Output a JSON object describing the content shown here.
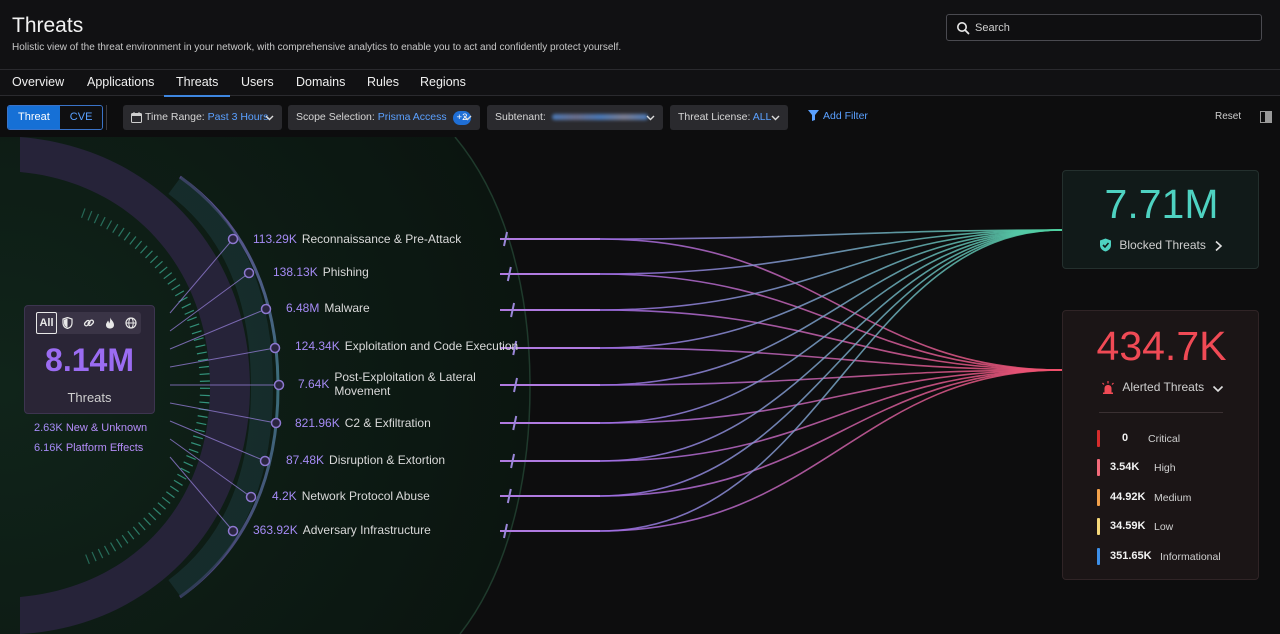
{
  "header": {
    "title": "Threats",
    "subtitle": "Holistic view of the threat environment in your network, with comprehensive analytics to enable you to act and confidently protect yourself.",
    "search_placeholder": "Search"
  },
  "tabs": [
    {
      "label": "Overview"
    },
    {
      "label": "Applications"
    },
    {
      "label": "Threats",
      "active": true
    },
    {
      "label": "Users"
    },
    {
      "label": "Domains"
    },
    {
      "label": "Rules"
    },
    {
      "label": "Regions"
    }
  ],
  "toolbar": {
    "view_toggle": {
      "threat": "Threat",
      "cve": "CVE",
      "selected": "Threat"
    },
    "time_range": {
      "label": "Time Range:",
      "value": "Past 3 Hours"
    },
    "scope": {
      "label": "Scope Selection:",
      "value": "Prisma Access",
      "badge": "+2"
    },
    "subtenant": {
      "label": "Subtenant:"
    },
    "license": {
      "label": "Threat License:",
      "value": "ALL"
    },
    "add_filter": "Add Filter",
    "reset": "Reset"
  },
  "summary": {
    "total": "8.14M",
    "total_label": "Threats",
    "filter_all": "All",
    "new_unknown": {
      "value": "2.63K",
      "label": "New & Unknown"
    },
    "platform_effects": {
      "value": "6.16K",
      "label": "Platform Effects"
    }
  },
  "categories": [
    {
      "value": "113.29K",
      "label": "Reconnaissance & Pre-Attack"
    },
    {
      "value": "138.13K",
      "label": "Phishing"
    },
    {
      "value": "6.48M",
      "label": "Malware"
    },
    {
      "value": "124.34K",
      "label": "Exploitation and Code Execution"
    },
    {
      "value": "7.64K",
      "label": "Post-Exploitation & Lateral Movement"
    },
    {
      "value": "821.96K",
      "label": "C2 & Exfiltration"
    },
    {
      "value": "87.48K",
      "label": "Disruption & Extortion"
    },
    {
      "value": "4.2K",
      "label": "Network Protocol Abuse"
    },
    {
      "value": "363.92K",
      "label": "Adversary Infrastructure"
    }
  ],
  "blocked": {
    "value": "7.71M",
    "label": "Blocked Threats"
  },
  "alerted": {
    "value": "434.7K",
    "label": "Alerted Threats",
    "severities": [
      {
        "value": "0",
        "label": "Critical",
        "color": "#d62c2c"
      },
      {
        "value": "3.54K",
        "label": "High",
        "color": "#f26a7a"
      },
      {
        "value": "44.92K",
        "label": "Medium",
        "color": "#f3a14b"
      },
      {
        "value": "34.59K",
        "label": "Low",
        "color": "#f5d77a"
      },
      {
        "value": "351.65K",
        "label": "Informational",
        "color": "#3d8fe8"
      }
    ]
  },
  "colors": {
    "accent": "#1670d6",
    "threat_purple": "#9b6cf2",
    "blocked_teal": "#4ed2c1",
    "alerted_red": "#f04a55"
  }
}
